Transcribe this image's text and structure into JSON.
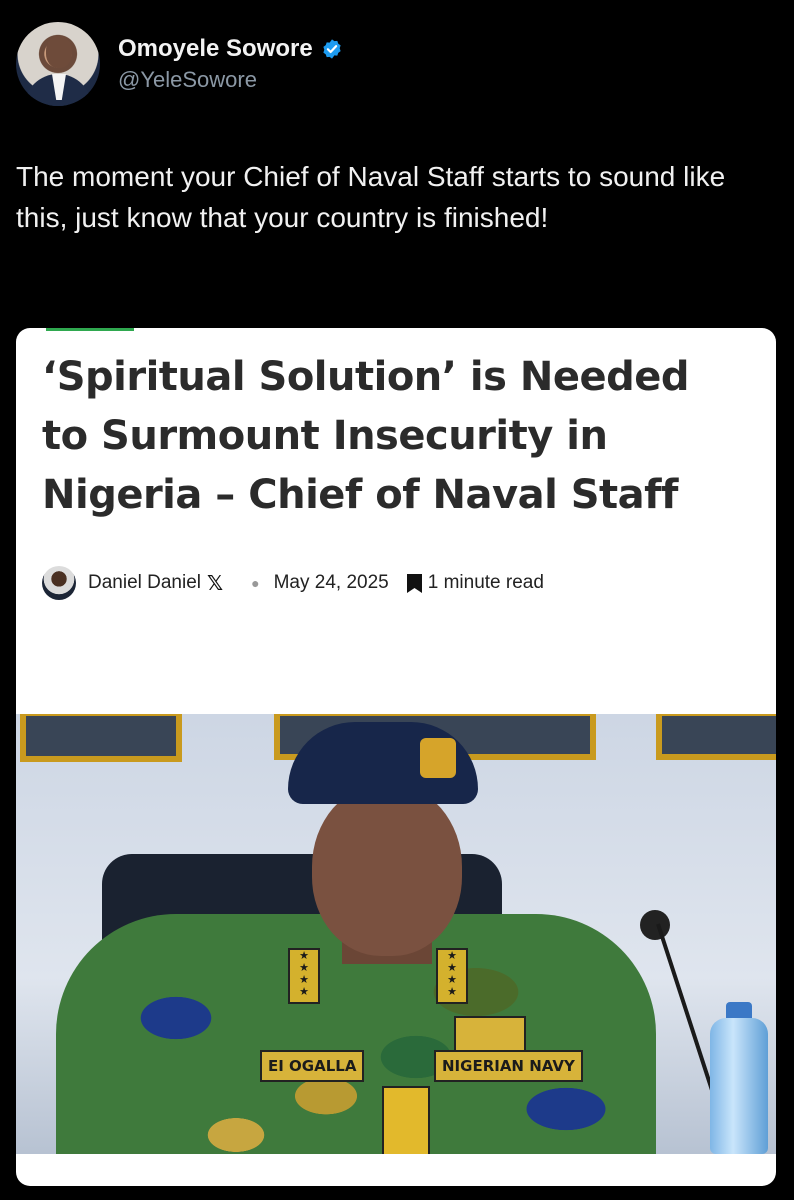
{
  "tweet": {
    "display_name": "Omoyele Sowore",
    "handle": "@YeleSowore",
    "verified": true,
    "text": "The moment your Chief of Naval Staff starts to sound like this, just know that your country is finished!"
  },
  "card": {
    "headline": "‘Spiritual Solution’ is Needed to Surmount Insecurity in Nigeria – Chief of Naval Staff",
    "author": "Daniel Daniel",
    "author_social_icon": "x-icon",
    "date": "May 24, 2025",
    "read_time": "1 minute read",
    "photo": {
      "name_tag": "EI OGALLA",
      "service_tag": "NIGERIAN NAVY"
    }
  },
  "colors": {
    "background": "#000000",
    "verified_blue": "#1d9bf0",
    "card_background": "#ffffff",
    "headline": "#2b2b2b",
    "accent_green": "#2fa84f"
  }
}
